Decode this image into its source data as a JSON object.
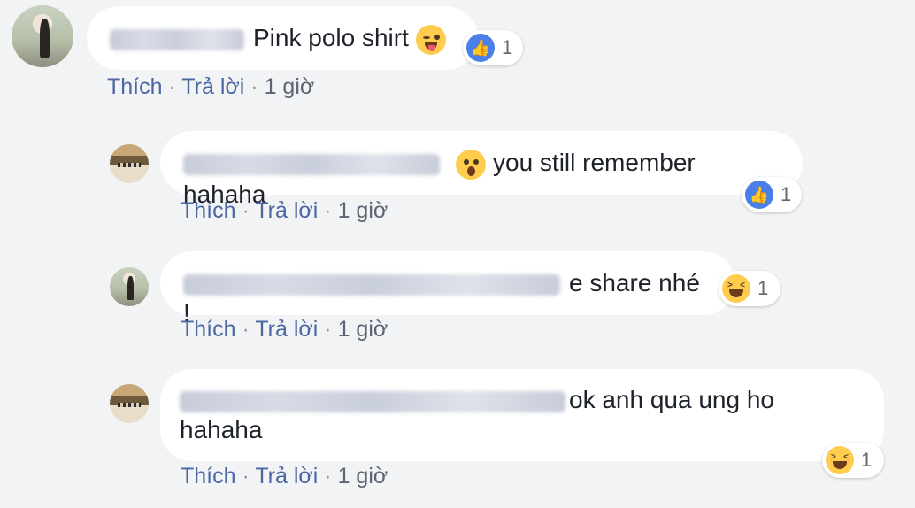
{
  "comments": [
    {
      "text": "Pink polo shirt",
      "reaction_count": "1",
      "reaction": "like",
      "actions": {
        "like": "Thích",
        "reply": "Trả lời",
        "time": "1 giờ"
      }
    },
    {
      "text": "you still remember hahaha",
      "reaction_count": "1",
      "reaction": "like",
      "actions": {
        "like": "Thích",
        "reply": "Trả lời",
        "time": "1 giờ"
      }
    },
    {
      "text": "e share nhé !",
      "reaction_count": "1",
      "reaction": "haha",
      "actions": {
        "like": "Thích",
        "reply": "Trả lời",
        "time": "1 giờ"
      }
    },
    {
      "text_line1": "ok anh qua ung ho",
      "text_line2": "hahaha",
      "reaction_count": "1",
      "reaction": "haha",
      "actions": {
        "like": "Thích",
        "reply": "Trả lời",
        "time": "1 giờ"
      }
    }
  ],
  "separator": "·",
  "colors": {
    "link": "#4b67a1",
    "like_blue": "#4a7ee8",
    "background": "#f2f3f5"
  }
}
